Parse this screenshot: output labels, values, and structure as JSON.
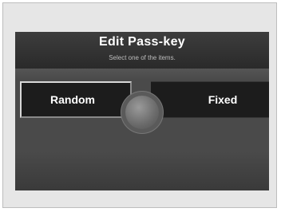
{
  "dialog": {
    "title": "Edit Pass-key",
    "subtitle": "Select one of the items."
  },
  "options": [
    {
      "label": "Random",
      "selected": true
    },
    {
      "label": "Fixed",
      "selected": false
    }
  ]
}
